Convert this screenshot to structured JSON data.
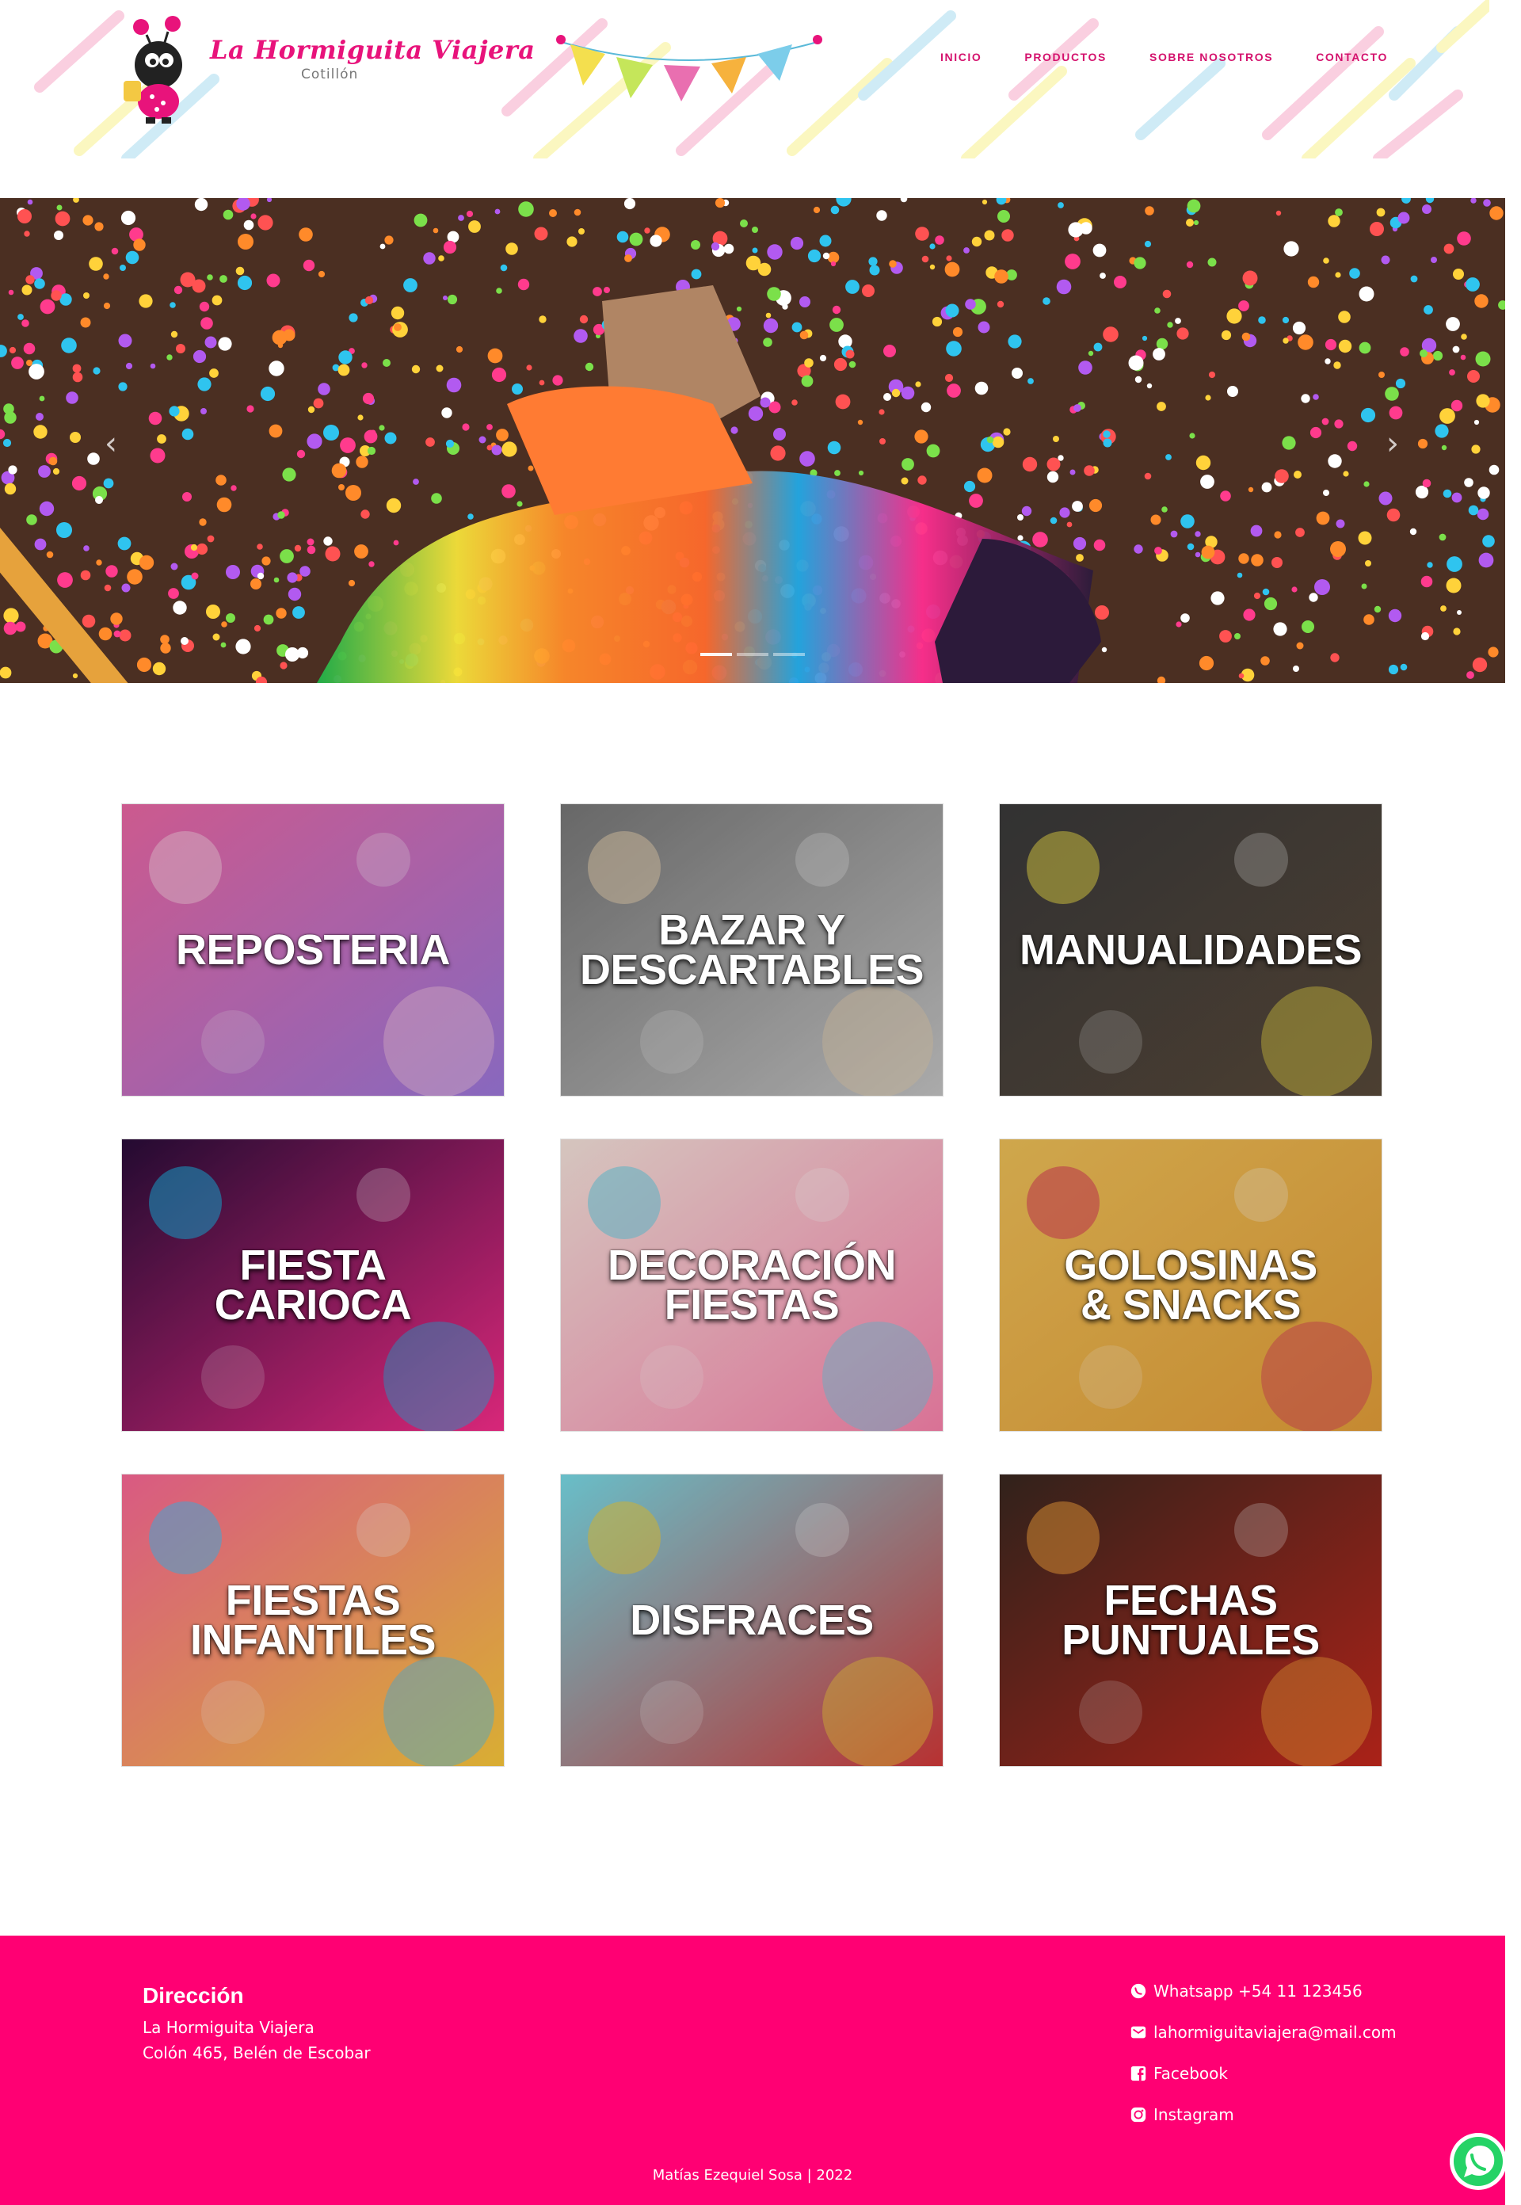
{
  "header": {
    "brand_name": "La Hormiguita Viajera",
    "brand_sub": "Cotillón",
    "nav": [
      "INICIO",
      "PRODUCTOS",
      "SOBRE NOSOTROS",
      "CONTACTO"
    ]
  },
  "hero": {
    "prev_icon": "chevron-left-icon",
    "next_icon": "chevron-right-icon",
    "slides": 3,
    "active_slide": 1
  },
  "categories": [
    {
      "title": "REPOSTERIA"
    },
    {
      "title": "BAZAR Y\nDESCARTABLES"
    },
    {
      "title": "MANUALIDADES"
    },
    {
      "title": "FIESTA\nCARIOCA"
    },
    {
      "title": "DECORACIÓN\nFIESTAS"
    },
    {
      "title": "GOLOSINAS\n& SNACKS"
    },
    {
      "title": "FIESTAS\nINFANTILES"
    },
    {
      "title": "DISFRACES"
    },
    {
      "title": "FECHAS\nPUNTUALES"
    }
  ],
  "footer": {
    "address_title": "Dirección",
    "address_lines": [
      "La Hormiguita Viajera",
      "Colón 465, Belén de Escobar"
    ],
    "contacts": [
      {
        "icon": "whatsapp-icon",
        "label": "Whatsapp +54 11 123456"
      },
      {
        "icon": "email-icon",
        "label": "lahormiguitaviajera@mail.com"
      },
      {
        "icon": "facebook-icon",
        "label": "Facebook"
      },
      {
        "icon": "instagram-icon",
        "label": "Instagram"
      }
    ],
    "credits": "Matías Ezequiel Sosa | 2022"
  },
  "colors": {
    "brand_pink": "#e8137b",
    "footer_bg": "#ff0073",
    "nav_text": "#d4126d"
  }
}
